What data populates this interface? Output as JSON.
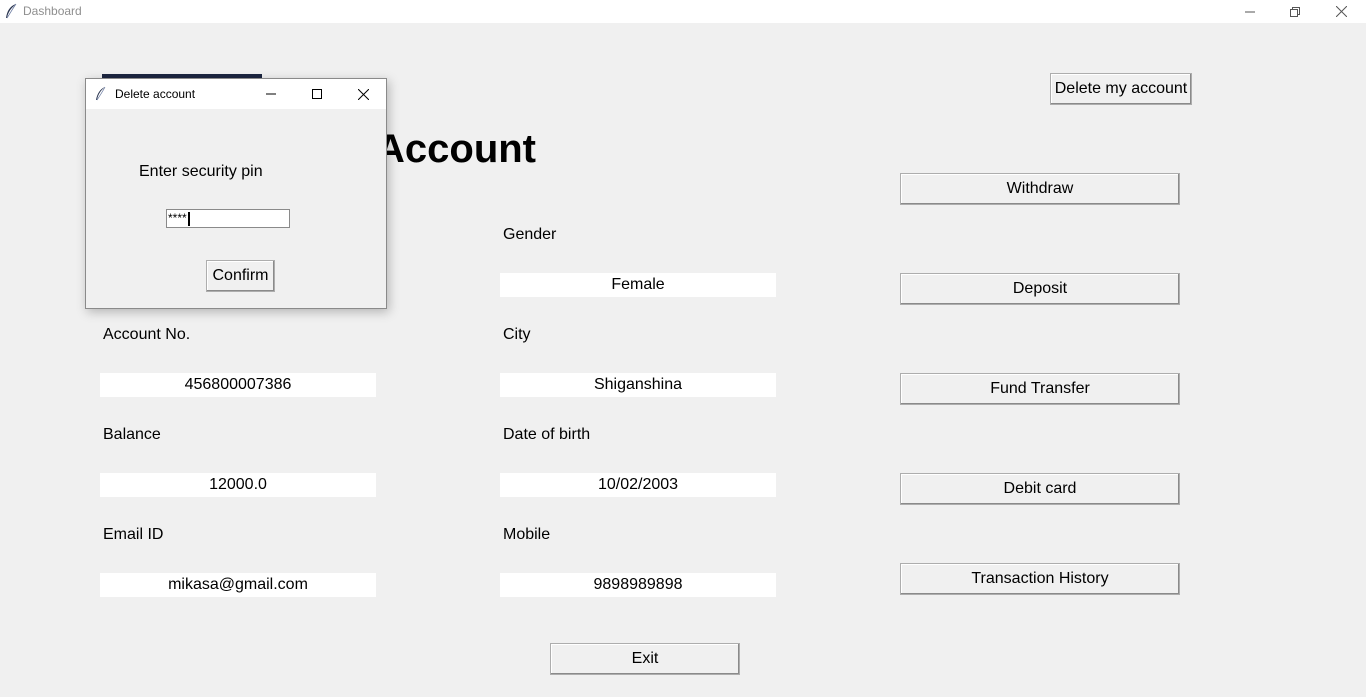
{
  "window": {
    "title": "Dashboard",
    "icon": "feather-icon",
    "controls": [
      "minimize-icon",
      "restore-icon",
      "close-icon"
    ]
  },
  "page": {
    "heading": "Account",
    "delete_account_label": "Delete my account"
  },
  "fields": {
    "gender": {
      "label": "Gender",
      "value": "Female"
    },
    "account_no": {
      "label": "Account No.",
      "value": "456800007386"
    },
    "city": {
      "label": "City",
      "value": "Shiganshina"
    },
    "balance": {
      "label": "Balance",
      "value": "12000.0"
    },
    "dob": {
      "label": "Date of birth",
      "value": "10/02/2003"
    },
    "email": {
      "label": "Email ID",
      "value": "mikasa@gmail.com"
    },
    "mobile": {
      "label": "Mobile",
      "value": "9898989898"
    }
  },
  "actions": {
    "withdraw": "Withdraw",
    "deposit": "Deposit",
    "fund_transfer": "Fund Transfer",
    "debit_card": "Debit card",
    "transaction_history": "Transaction History",
    "exit": "Exit"
  },
  "dialog": {
    "title": "Delete account",
    "prompt": "Enter security pin",
    "pin_value": "****",
    "confirm_label": "Confirm",
    "controls": [
      "minimize-icon",
      "maximize-icon",
      "close-icon"
    ]
  }
}
